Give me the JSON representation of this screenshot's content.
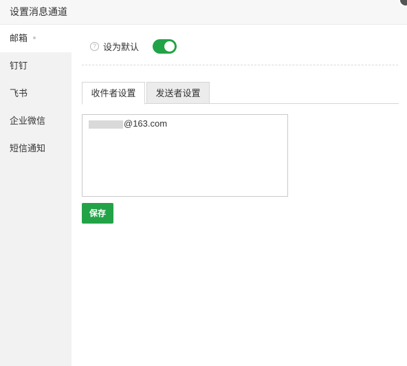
{
  "window": {
    "title": "设置消息通道"
  },
  "sidebar": {
    "items": [
      {
        "label": "邮箱",
        "active": true
      },
      {
        "label": "钉钉"
      },
      {
        "label": "飞书"
      },
      {
        "label": "企业微信"
      },
      {
        "label": "短信通知"
      }
    ]
  },
  "settings": {
    "help_icon": "question-circle-icon",
    "default_label": "设为默认",
    "default_enabled": true
  },
  "tabs": [
    {
      "label": "收件者设置",
      "active": true
    },
    {
      "label": "发送者设置"
    }
  ],
  "recipient": {
    "email_suffix": "@163.com"
  },
  "actions": {
    "save_label": "保存"
  },
  "colors": {
    "accent": "#23a347",
    "sidebar_bg": "#f2f2f2"
  }
}
